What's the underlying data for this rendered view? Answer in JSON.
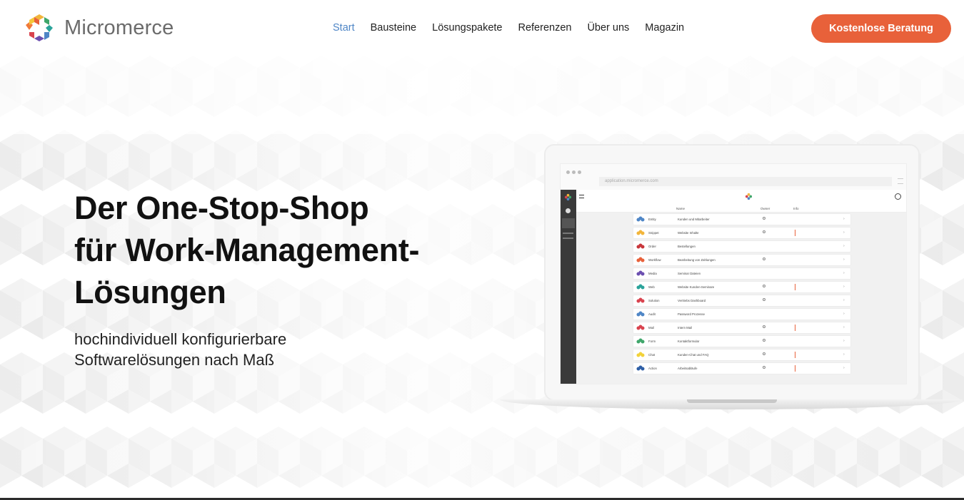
{
  "brand": {
    "name": "Micromerce",
    "colors": [
      "#e8613a",
      "#f2b53a",
      "#4f86c6",
      "#6c4fb0",
      "#d9434e",
      "#3fa66b"
    ]
  },
  "nav": {
    "items": [
      "Start",
      "Bausteine",
      "Lösungspakete",
      "Referenzen",
      "Über uns",
      "Magazin"
    ],
    "active_index": 0,
    "active_color": "#4f86c6"
  },
  "cta": {
    "label": "Kostenlose Beratung",
    "color": "#e8613a"
  },
  "hero": {
    "title_lines": [
      "Der One-Stop-Shop",
      "für Work-Management-",
      "Lösungen"
    ],
    "subtitle_lines": [
      "hochindividuell konfigurierbare",
      "Softwarelösungen nach Maß"
    ]
  },
  "preview": {
    "url": "application.micromerce.com",
    "columns": [
      "Name",
      "Owner",
      "Info"
    ],
    "rows": [
      {
        "name": "Entity",
        "desc": "Kunden und Mitarbeiter",
        "owner": true,
        "info": false,
        "color": "#4f86c6"
      },
      {
        "name": "Snippet",
        "desc": "Website Inhalte",
        "owner": true,
        "info": true,
        "color": "#f2b53a"
      },
      {
        "name": "Order",
        "desc": "Bestellungen",
        "owner": false,
        "info": false,
        "color": "#c8363b"
      },
      {
        "name": "Workflow",
        "desc": "Bearbeitung von Zahlungen",
        "owner": true,
        "info": false,
        "color": "#e8613a"
      },
      {
        "name": "Media",
        "desc": "Seminar Dateien",
        "owner": false,
        "info": false,
        "color": "#6c4fb0"
      },
      {
        "name": "Web",
        "desc": "Website Kunden-Seminare",
        "owner": true,
        "info": true,
        "color": "#2aa39a"
      },
      {
        "name": "Solution",
        "desc": "Vertriebs Dashboard",
        "owner": true,
        "info": false,
        "color": "#d9434e"
      },
      {
        "name": "Audit",
        "desc": "Password Prozesse",
        "owner": false,
        "info": false,
        "color": "#4f86c6"
      },
      {
        "name": "Mail",
        "desc": "Intern Mail",
        "owner": true,
        "info": true,
        "color": "#d9434e"
      },
      {
        "name": "Form",
        "desc": "Kontaktformular",
        "owner": true,
        "info": false,
        "color": "#3fa66b"
      },
      {
        "name": "Chat",
        "desc": "Kunden-Chat und FAQ",
        "owner": true,
        "info": true,
        "color": "#f2d23a"
      },
      {
        "name": "Action",
        "desc": "Arbeitsabläufe",
        "owner": true,
        "info": true,
        "color": "#2f5fa6"
      }
    ]
  }
}
